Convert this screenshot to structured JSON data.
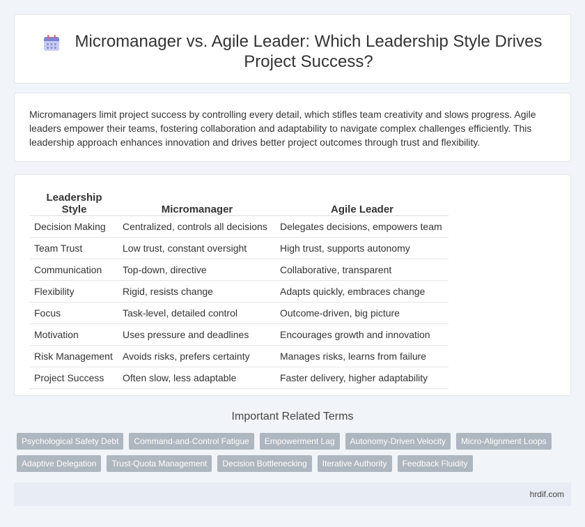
{
  "header": {
    "title": "Micromanager vs. Agile Leader: Which Leadership Style Drives Project Success?"
  },
  "intro": {
    "text": "Micromanagers limit project success by controlling every detail, which stifles team creativity and slows progress. Agile leaders empower their teams, fostering collaboration and adaptability to navigate complex challenges efficiently. This leadership approach enhances innovation and drives better project outcomes through trust and flexibility."
  },
  "table": {
    "headers": [
      "Leadership Style",
      "Micromanager",
      "Agile Leader"
    ],
    "rows": [
      [
        "Decision Making",
        "Centralized, controls all decisions",
        "Delegates decisions, empowers team"
      ],
      [
        "Team Trust",
        "Low trust, constant oversight",
        "High trust, supports autonomy"
      ],
      [
        "Communication",
        "Top-down, directive",
        "Collaborative, transparent"
      ],
      [
        "Flexibility",
        "Rigid, resists change",
        "Adapts quickly, embraces change"
      ],
      [
        "Focus",
        "Task-level, detailed control",
        "Outcome-driven, big picture"
      ],
      [
        "Motivation",
        "Uses pressure and deadlines",
        "Encourages growth and innovation"
      ],
      [
        "Risk Management",
        "Avoids risks, prefers certainty",
        "Manages risks, learns from failure"
      ],
      [
        "Project Success",
        "Often slow, less adaptable",
        "Faster delivery, higher adaptability"
      ]
    ]
  },
  "related": {
    "title": "Important Related Terms",
    "row1": [
      "Psychological Safety Debt",
      "Command-and-Control Fatigue",
      "Empowerment Lag",
      "Autonomy-Driven Velocity",
      "Micro-Alignment Loops"
    ],
    "row2": [
      "Adaptive Delegation",
      "Trust-Quota Management",
      "Decision Bottlenecking",
      "Iterative Authority",
      "Feedback Fluidity"
    ]
  },
  "footer": {
    "site": "hrdif.com"
  },
  "icons": {
    "title_icon": "calendar-icon"
  },
  "colors": {
    "tag_bg": "#aeb6c0",
    "footer_bg": "#e7ecf5",
    "page_bg": "#f1f4f8"
  }
}
